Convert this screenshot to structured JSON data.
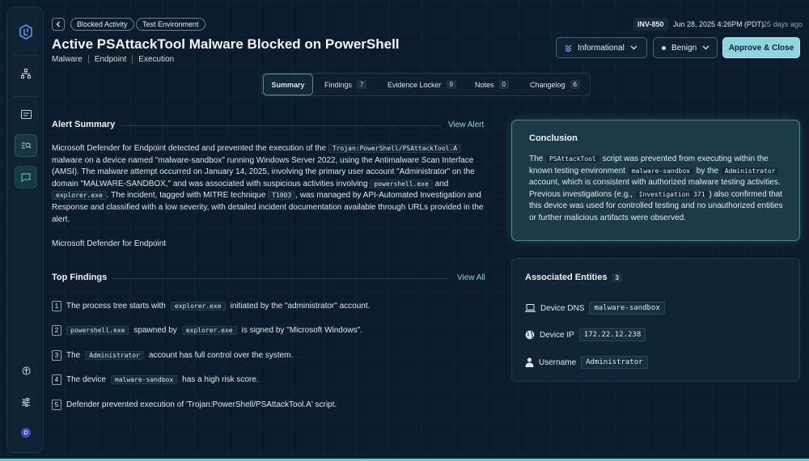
{
  "header": {
    "breadcrumb": [
      "Blocked Activity",
      "Test Environment"
    ],
    "title": "Active PSAttackTool Malware Blocked on PowerShell",
    "tags": [
      "Malware",
      "Endpoint",
      "Execution"
    ],
    "inv_id": "INV-850",
    "date": "Jun 28, 2025 4:26PM (PDT)",
    "ago": "25 days ago",
    "severity_label": "Informational",
    "verdict_label": "Benign",
    "approve_label": "Approve & Close"
  },
  "tabs": [
    {
      "label": "Summary",
      "count": null
    },
    {
      "label": "Findings",
      "count": "7"
    },
    {
      "label": "Evidence Locker",
      "count": "9"
    },
    {
      "label": "Notes",
      "count": "0"
    },
    {
      "label": "Changelog",
      "count": "6"
    }
  ],
  "alert_summary": {
    "title": "Alert Summary",
    "link": "View Alert",
    "t1": "Microsoft Defender for Endpoint detected and prevented the execution of the",
    "c1": "Trojan:PowerShell/PSAttackTool.A",
    "t2": "malware on a device named \"malware-sandbox\" running Windows Server 2022, using the Antimalware Scan Interface (AMSI). The malware attempt occurred on January 14, 2025, involving the primary user account \"Administrator\" on the domain \"MALWARE-SANDBOX,\" and was associated with suspicious activities involving",
    "c2": "powershell.exe",
    "t3": "and",
    "c3": "explorer.exe",
    "t4": ". The incident, tagged with MITRE technique",
    "c4": "T1003",
    "t5": ", was managed by API-Automated Investigation and Response and classified with a low severity, with detailed incident documentation available through URLs provided in the alert.",
    "source": "Microsoft Defender for Endpoint"
  },
  "top_findings": {
    "title": "Top Findings",
    "link": "View All",
    "items": [
      {
        "n": "1",
        "a": "The process tree starts with",
        "c1": "explorer.exe",
        "b": "initiated by the \"administrator\" account.",
        "c2": "",
        "d": ""
      },
      {
        "n": "2",
        "a": "",
        "c1": "powershell.exe",
        "b": "spawned by",
        "c2": "explorer.exe",
        "d": "is signed by \"Microsoft Windows\"."
      },
      {
        "n": "3",
        "a": "The",
        "c1": "Administrator",
        "b": "account has full control over the system.",
        "c2": "",
        "d": ""
      },
      {
        "n": "4",
        "a": "The device",
        "c1": "malware-sandbox",
        "b": "has a high risk score.",
        "c2": "",
        "d": ""
      },
      {
        "n": "5",
        "a": "Defender prevented execution of 'Trojan:PowerShell/PSAttackTool.A' script.",
        "c1": "",
        "b": "",
        "c2": "",
        "d": ""
      }
    ]
  },
  "conclusion": {
    "title": "Conclusion",
    "t1": "The",
    "c1": "PSAttackTool",
    "t2": "script was prevented from executing within the known testing environment",
    "c2": "malware-sandbox",
    "t3": "by the",
    "c3": "Administrator",
    "t4": "account, which is consistent with authorized malware testing activities. Previous investigations (e.g.,",
    "c4": "Investigation 371",
    "t5": ") also confirmed that this device was used for controlled testing and no unauthorized entities or further malicious artifacts were observed."
  },
  "entities": {
    "title": "Associated Entities",
    "count": "3",
    "rows": [
      {
        "label": "Device DNS",
        "value": "malware-sandbox",
        "icon": "laptop-icon"
      },
      {
        "label": "Device IP",
        "value": "172.22.12.238",
        "icon": "globe-icon"
      },
      {
        "label": "Username",
        "value": "Administrator",
        "icon": "user-icon"
      }
    ]
  },
  "sidebar": {
    "avatar_initial": "D"
  },
  "colors": {
    "accent": "#8ed5e0",
    "background": "#0b1c2c"
  }
}
